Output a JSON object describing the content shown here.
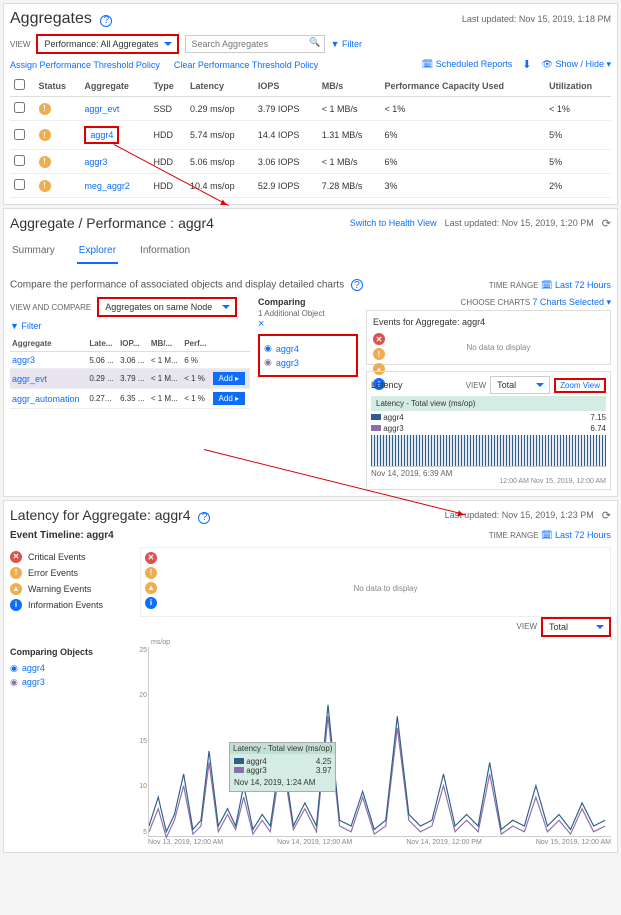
{
  "p1": {
    "title": "Aggregates",
    "updated": "Last updated: Nov 15, 2019, 1:18 PM",
    "view_lbl": "VIEW",
    "view_sel": "Performance: All Aggregates",
    "search_ph": "Search Aggregates",
    "filter": "Filter",
    "assign": "Assign Performance Threshold Policy",
    "clear": "Clear Performance Threshold Policy",
    "sched": "Scheduled Reports",
    "showhide": "Show / Hide",
    "cols": {
      "status": "Status",
      "agg": "Aggregate",
      "type": "Type",
      "lat": "Latency",
      "iops": "IOPS",
      "mbs": "MB/s",
      "pcap": "Performance Capacity Used",
      "util": "Utilization"
    },
    "rows": [
      {
        "name": "aggr_evt",
        "type": "SSD",
        "lat": "0.29 ms/op",
        "iops": "3.79 IOPS",
        "mbs": "< 1 MB/s",
        "pcap": "< 1%",
        "util": "< 1%",
        "hl": false
      },
      {
        "name": "aggr4",
        "type": "HDD",
        "lat": "5.74 ms/op",
        "iops": "14.4 IOPS",
        "mbs": "1.31 MB/s",
        "pcap": "6%",
        "util": "5%",
        "hl": true
      },
      {
        "name": "aggr3",
        "type": "HDD",
        "lat": "5.06 ms/op",
        "iops": "3.06 IOPS",
        "mbs": "< 1 MB/s",
        "pcap": "6%",
        "util": "5%",
        "hl": false
      },
      {
        "name": "meg_aggr2",
        "type": "HDD",
        "lat": "10.4 ms/op",
        "iops": "52.9 IOPS",
        "mbs": "7.28 MB/s",
        "pcap": "3%",
        "util": "2%",
        "hl": false
      }
    ]
  },
  "p2": {
    "title": "Aggregate / Performance : aggr4",
    "switch": "Switch to Health View",
    "updated": "Last updated: Nov 15, 2019, 1:20 PM",
    "tabs": {
      "summary": "Summary",
      "explorer": "Explorer",
      "info": "Information"
    },
    "sub": "Compare the performance of associated objects and display detailed charts",
    "timerange_lbl": "TIME RANGE",
    "timerange": "Last 72 Hours",
    "vc_lbl": "VIEW AND COMPARE",
    "vc_sel": "Aggregates on same Node",
    "filter": "Filter",
    "mini_cols": {
      "agg": "Aggregate",
      "lat": "Late...",
      "iops": "IOP...",
      "mbs": "MB/...",
      "perf": "Perf..."
    },
    "mini_rows": [
      {
        "name": "aggr3",
        "lat": "5.06 ...",
        "iops": "3.06 ...",
        "mbs": "< 1 M...",
        "perf": "6 %",
        "add": false
      },
      {
        "name": "aggr_evt",
        "lat": "0.29 ...",
        "iops": "3.79 ...",
        "mbs": "< 1 M...",
        "perf": "< 1 %",
        "add": true,
        "sel": true
      },
      {
        "name": "aggr_automation",
        "lat": "0.27...",
        "iops": "6.35 ...",
        "mbs": "< 1 M...",
        "perf": "< 1 %",
        "add": true
      }
    ],
    "add": "Add",
    "comparing": "Comparing",
    "additional": "1 Additional Object",
    "cmp": [
      "aggr4",
      "aggr3"
    ],
    "choose_lbl": "CHOOSE CHARTS",
    "choose": "7 Charts Selected",
    "ev_title": "Events for Aggregate: aggr4",
    "nodata": "No data to display",
    "chart": {
      "name": "Latency",
      "view_lbl": "VIEW",
      "view": "Total",
      "zoom": "Zoom View",
      "band": "Latency - Total view (ms/op)",
      "l1": "aggr4",
      "l2": "aggr3",
      "v1": "7.15",
      "v2": "6.74",
      "ts": "Nov 14, 2019, 6:39 AM",
      "ax": [
        "",
        "12:00 AM Nov 15, 2019, 12:00 AM"
      ]
    }
  },
  "p3": {
    "title": "Latency for Aggregate: aggr4",
    "updated": "Last updated: Nov 15, 2019, 1:23 PM",
    "et": "Event Timeline: aggr4",
    "timerange_lbl": "TIME RANGE",
    "timerange": "Last 72 Hours",
    "ev": {
      "crit": "Critical Events",
      "err": "Error Events",
      "warn": "Warning Events",
      "info": "Information Events"
    },
    "nodata": "No data to display",
    "view_lbl": "VIEW",
    "view": "Total",
    "comp": "Comparing Objects",
    "c1": "aggr4",
    "c2": "aggr3",
    "unit": "ms/op",
    "yticks": [
      "25",
      "20",
      "15",
      "10",
      "5"
    ],
    "tip": {
      "band": "Latency - Total view (ms/op)",
      "l1": "aggr4",
      "l2": "aggr3",
      "v1": "4.25",
      "v2": "3.97",
      "ts": "Nov 14, 2019, 1:24 AM"
    },
    "xax": [
      "Nov 13, 2019, 12:00 AM",
      "Nov 14, 2019, 12:00 AM",
      "Nov 14, 2019, 12:00 PM",
      "Nov 15, 2019, 12:00 AM"
    ]
  },
  "chart_data": {
    "type": "line",
    "title": "Latency - Total view (ms/op)",
    "ylabel": "ms/op",
    "ylim": [
      0,
      25
    ],
    "x_range": [
      "Nov 13, 2019 00:00",
      "Nov 15, 2019 12:00"
    ],
    "series": [
      {
        "name": "aggr4",
        "color": "#2e5f8a",
        "sample": {
          "t": "Nov 14, 2019 01:24",
          "v": 4.25
        },
        "approx_mean": 5.5,
        "approx_peak": 22
      },
      {
        "name": "aggr3",
        "color": "#8b6fa8",
        "sample": {
          "t": "Nov 14, 2019 01:24",
          "v": 3.97
        },
        "approx_mean": 5.0,
        "approx_peak": 20
      }
    ]
  }
}
